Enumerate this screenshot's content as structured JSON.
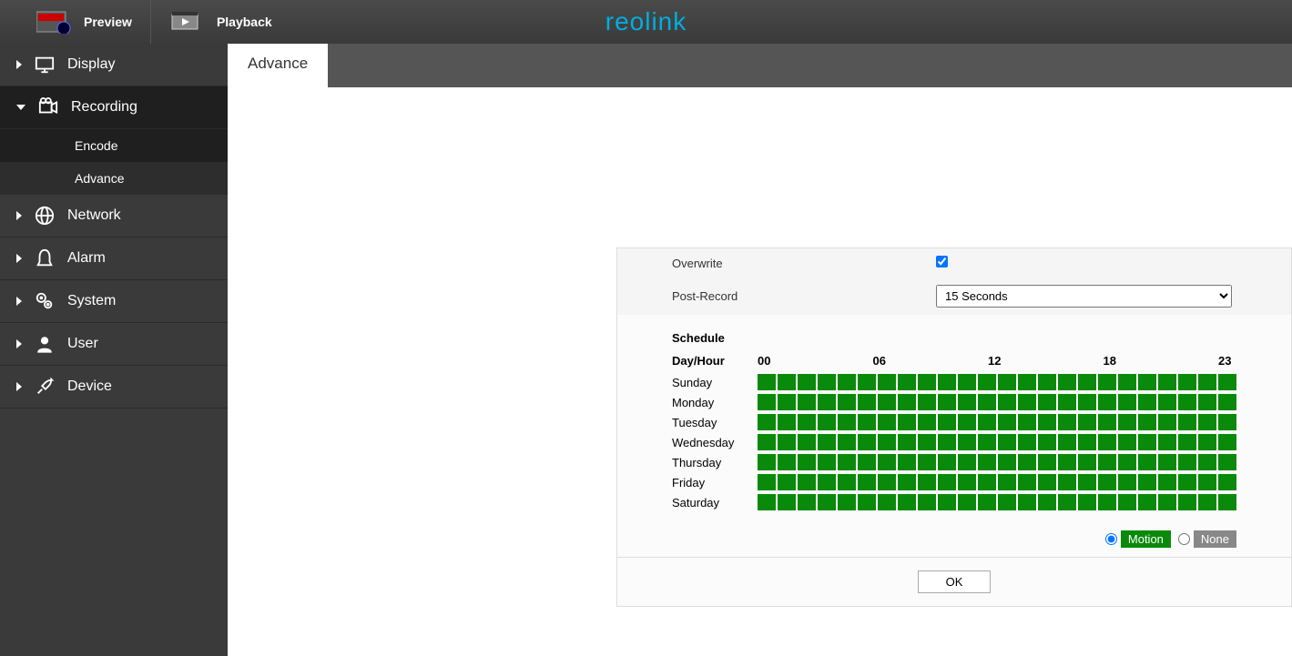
{
  "header": {
    "preview": "Preview",
    "playback": "Playback",
    "logo": "reolink"
  },
  "sidebar": {
    "display": "Display",
    "recording": "Recording",
    "recording_sub": {
      "encode": "Encode",
      "advance": "Advance"
    },
    "network": "Network",
    "alarm": "Alarm",
    "system": "System",
    "user": "User",
    "device": "Device"
  },
  "tab": {
    "advance": "Advance"
  },
  "settings": {
    "overwrite_label": "Overwrite",
    "overwrite_checked": true,
    "post_record_label": "Post-Record",
    "post_record_value": "15 Seconds"
  },
  "schedule": {
    "title": "Schedule",
    "day_hour": "Day/Hour",
    "days": [
      "Sunday",
      "Monday",
      "Tuesday",
      "Wednesday",
      "Thursday",
      "Friday",
      "Saturday"
    ],
    "hour_labels": [
      "00",
      "06",
      "12",
      "18",
      "23"
    ],
    "motion_label": "Motion",
    "none_label": "None",
    "ok": "OK"
  }
}
